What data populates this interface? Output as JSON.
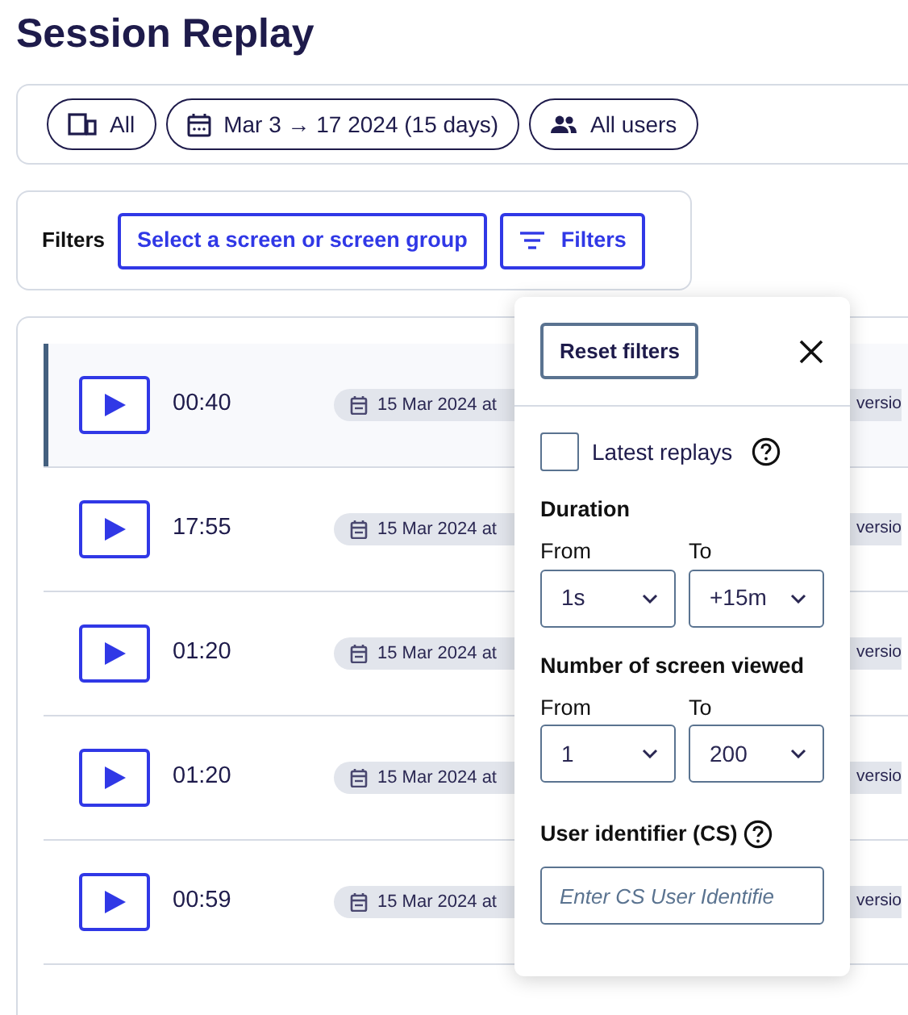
{
  "title": "Session Replay",
  "scope_pills": [
    {
      "kind": "device",
      "label": "All"
    },
    {
      "kind": "date",
      "label": "Mar 3 → 17 2024 (15 days)"
    },
    {
      "kind": "users",
      "label": "All users"
    }
  ],
  "filters_bar": {
    "label": "Filters",
    "screen_button": "Select a screen or screen group",
    "filters_button": "Filters"
  },
  "replays": [
    {
      "duration": "00:40",
      "date": "15 Mar 2024 at",
      "tag": "versio",
      "selected": true
    },
    {
      "duration": "17:55",
      "date": "15 Mar 2024 at",
      "tag": "versio",
      "selected": false
    },
    {
      "duration": "01:20",
      "date": "15 Mar 2024 at",
      "tag": "versio",
      "selected": false
    },
    {
      "duration": "01:20",
      "date": "15 Mar 2024 at",
      "tag": "versio",
      "selected": false
    },
    {
      "duration": "00:59",
      "date": "15 Mar 2024 at",
      "tag": "versio",
      "selected": false
    }
  ],
  "filter_popover": {
    "reset_button": "Reset filters",
    "latest_replays": {
      "label": "Latest replays",
      "checked": false
    },
    "sections": [
      {
        "title": "Duration",
        "from_label": "From",
        "from_value": "1s",
        "to_label": "To",
        "to_value": "+15m"
      },
      {
        "title": "Number of screen viewed",
        "from_label": "From",
        "from_value": "1",
        "to_label": "To",
        "to_value": "200"
      }
    ],
    "user_identifier": {
      "title": "User identifier (CS)",
      "placeholder": "Enter CS User Identifie"
    }
  }
}
